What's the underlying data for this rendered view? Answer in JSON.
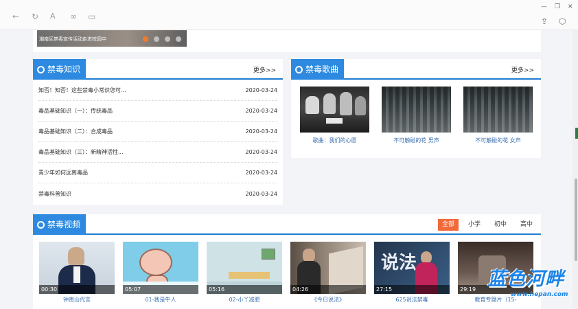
{
  "toolbar": {
    "icons": [
      "back-arrow-icon",
      "refresh-icon",
      "text-icon",
      "link-icon",
      "layout-icon",
      "share-icon",
      "box-icon"
    ],
    "window_buttons": [
      "minimize-icon",
      "restore-icon",
      "close-icon"
    ]
  },
  "banner": {
    "caption": "潮南区禁毒宣传活动走进校园中",
    "active_dot": 0,
    "dots": 4,
    "active_color": "#f07a2b"
  },
  "knowledge": {
    "title": "禁毒知识",
    "more": "更多>>",
    "items": [
      {
        "title": "知否！知否！这些禁毒小常识您可...",
        "date": "2020-03-24"
      },
      {
        "title": "毒品基础知识（一）：传统毒品",
        "date": "2020-03-24"
      },
      {
        "title": "毒品基础知识（二）：合成毒品",
        "date": "2020-03-24"
      },
      {
        "title": "毒品基础知识（三）：新精神活性...",
        "date": "2020-03-24"
      },
      {
        "title": "青少年如何远离毒品",
        "date": "2020-03-24"
      },
      {
        "title": "禁毒科普知识",
        "date": "2020-03-24"
      }
    ]
  },
  "songs": {
    "title": "禁毒歌曲",
    "more": "更多>>",
    "items": [
      {
        "caption": "歌曲：我们的心愿"
      },
      {
        "caption": "不可触碰的花 男声"
      },
      {
        "caption": "不可触碰的花 女声"
      }
    ]
  },
  "videos": {
    "title": "禁毒视频",
    "tabs": [
      "全部",
      "小学",
      "初中",
      "高中"
    ],
    "active_tab": 0,
    "items": [
      {
        "duration": "00:30",
        "caption": "钟南山代言"
      },
      {
        "duration": "05:07",
        "caption": "01-我是牛人"
      },
      {
        "duration": "05:16",
        "caption": "02-小丫减肥"
      },
      {
        "duration": "04:26",
        "caption": "《今日说法》"
      },
      {
        "duration": "27:15",
        "caption": "625说法禁毒"
      },
      {
        "duration": "29:19",
        "caption": "教育专题片（15-"
      }
    ]
  },
  "watermark": {
    "text": "蓝色河畔",
    "url": "www.hepan.com"
  },
  "colors": {
    "accent": "#2d8ae0",
    "tab_active": "#f06a3b",
    "link": "#3b6fb0"
  }
}
